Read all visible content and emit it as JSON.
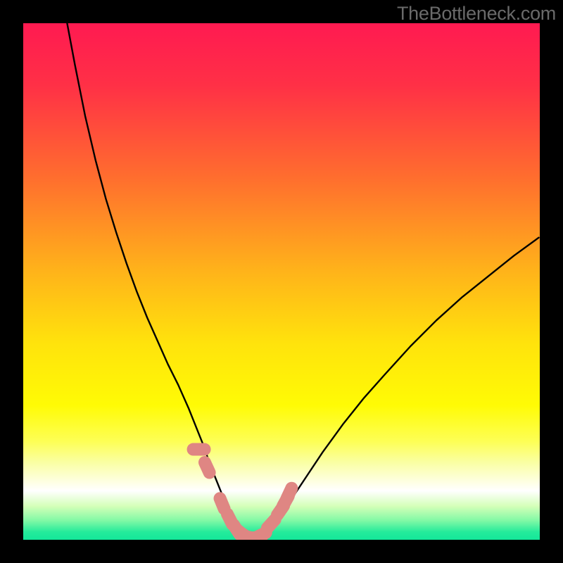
{
  "watermark": "TheBottleneck.com",
  "chart_data": {
    "type": "line",
    "title": "",
    "xlabel": "",
    "ylabel": "",
    "xlim": [
      0,
      100
    ],
    "ylim": [
      0,
      100
    ],
    "background": {
      "type": "vertical-gradient",
      "stops": [
        {
          "pos": 0.0,
          "color": "#ff1a51"
        },
        {
          "pos": 0.12,
          "color": "#ff3046"
        },
        {
          "pos": 0.3,
          "color": "#ff6e2e"
        },
        {
          "pos": 0.48,
          "color": "#ffb31a"
        },
        {
          "pos": 0.62,
          "color": "#ffe30c"
        },
        {
          "pos": 0.74,
          "color": "#fffb05"
        },
        {
          "pos": 0.81,
          "color": "#fdff56"
        },
        {
          "pos": 0.85,
          "color": "#faffa3"
        },
        {
          "pos": 0.905,
          "color": "#ffffff"
        },
        {
          "pos": 0.935,
          "color": "#d4ffb8"
        },
        {
          "pos": 0.962,
          "color": "#84f9a6"
        },
        {
          "pos": 0.985,
          "color": "#24eb9b"
        },
        {
          "pos": 1.0,
          "color": "#14e79a"
        }
      ]
    },
    "series": [
      {
        "name": "bottleneck-curve",
        "scatter": false,
        "stroke": "#000000",
        "x": [
          8.5,
          10,
          12,
          14,
          16,
          18,
          20,
          22,
          24,
          26,
          28,
          30,
          32,
          33,
          34,
          35,
          36,
          37,
          38,
          39,
          40,
          41,
          42,
          43,
          44,
          45,
          46,
          48,
          50,
          52,
          55,
          58,
          62,
          66,
          70,
          75,
          80,
          85,
          90,
          95,
          99.8
        ],
        "y": [
          100,
          92,
          82,
          73.5,
          66,
          59.5,
          53.5,
          48,
          43,
          38.5,
          34,
          30,
          25.5,
          23,
          20.5,
          18,
          15,
          12.5,
          10,
          7.5,
          5,
          3,
          1.5,
          0.6,
          0.2,
          0.2,
          0.8,
          2.5,
          5,
          8,
          12.5,
          17,
          22.5,
          27.5,
          32,
          37.5,
          42.5,
          47,
          51,
          55,
          58.5
        ]
      },
      {
        "name": "optimal-range-markers",
        "scatter": true,
        "stroke": "#df8683",
        "x": [
          34,
          35.6,
          38.5,
          40,
          41.3,
          42.3,
          43.2,
          44.1,
          45,
          46,
          48,
          49.8,
          50.8,
          51.5
        ],
        "y": [
          17.5,
          14,
          7,
          4,
          2,
          1.2,
          0.6,
          0.4,
          0.4,
          0.9,
          3.1,
          5.7,
          7.5,
          9
        ]
      }
    ]
  }
}
